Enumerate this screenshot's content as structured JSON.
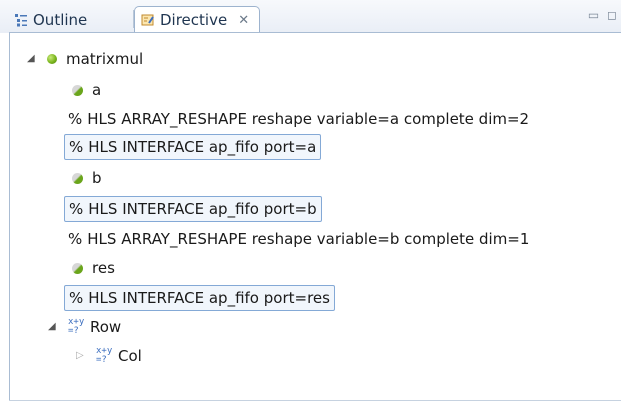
{
  "tabs": [
    {
      "label": "Outline",
      "icon": "outline-icon",
      "active": false
    },
    {
      "label": "Directive",
      "icon": "directive-icon",
      "active": true,
      "close": "✕"
    }
  ],
  "window_controls": "▭ ◻",
  "tree": {
    "root": {
      "label": "matrixmul",
      "expanded": true
    },
    "nodes": [
      {
        "type": "variable",
        "label": "a"
      },
      {
        "type": "directive",
        "label": "HLS ARRAY_RESHAPE reshape variable=a complete dim=2",
        "prefix": "%",
        "selected": false
      },
      {
        "type": "directive",
        "label": "HLS INTERFACE ap_fifo port=a",
        "prefix": "%",
        "selected": true
      },
      {
        "type": "variable",
        "label": "b"
      },
      {
        "type": "directive",
        "label": "HLS INTERFACE ap_fifo port=b",
        "prefix": "%",
        "selected": true
      },
      {
        "type": "directive",
        "label": "HLS ARRAY_RESHAPE reshape variable=b complete dim=1",
        "prefix": "%",
        "selected": false
      },
      {
        "type": "variable",
        "label": "res"
      },
      {
        "type": "directive",
        "label": "HLS INTERFACE ap_fifo port=res",
        "prefix": "%",
        "selected": true
      },
      {
        "type": "loop",
        "label": "Row",
        "expanded": true
      },
      {
        "type": "loop",
        "label": "Col",
        "expanded": false
      }
    ]
  },
  "colors": {
    "selection_border": "#84a9d6",
    "selection_fill": "#f1f6fc",
    "bullet_green": "#7ab51d",
    "tab_border": "#9db3ce"
  }
}
